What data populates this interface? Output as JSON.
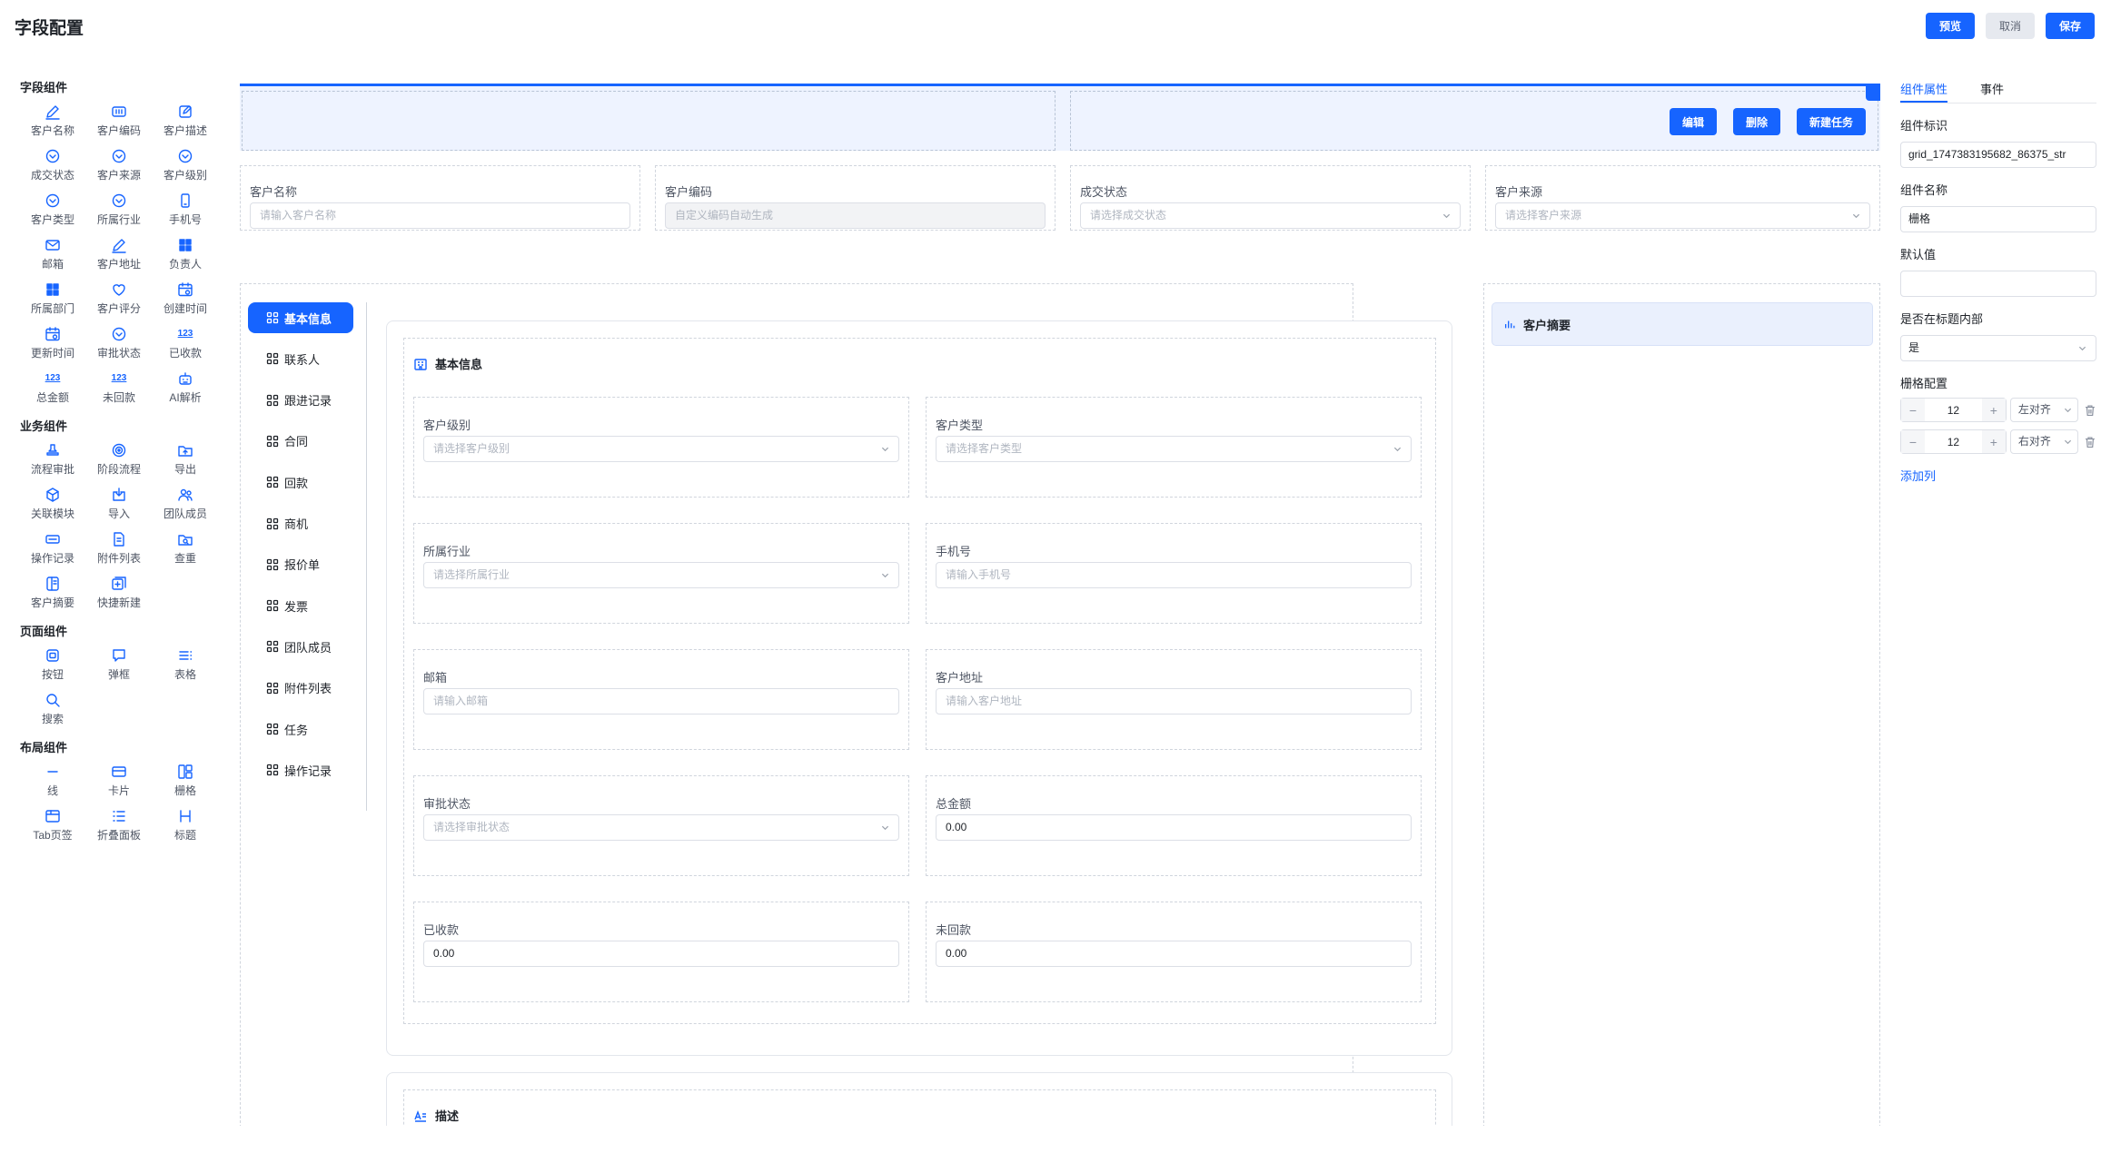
{
  "header": {
    "title": "字段配置",
    "actions": {
      "preview": "预览",
      "cancel": "取消",
      "save": "保存"
    }
  },
  "colors": {
    "primary": "#1664ff",
    "summary_bg": "#eaf0fd",
    "selected_bg": "#eef3ff"
  },
  "palette": {
    "sections": [
      {
        "title": "字段组件",
        "items": [
          {
            "label": "客户名称",
            "icon": "pen-icon"
          },
          {
            "label": "客户编码",
            "icon": "barcode-icon"
          },
          {
            "label": "客户描述",
            "icon": "edit-icon"
          },
          {
            "label": "成交状态",
            "icon": "chevron-circle-icon"
          },
          {
            "label": "客户来源",
            "icon": "chevron-circle-icon"
          },
          {
            "label": "客户级别",
            "icon": "chevron-circle-icon"
          },
          {
            "label": "客户类型",
            "icon": "chevron-circle-icon"
          },
          {
            "label": "所属行业",
            "icon": "chevron-circle-icon"
          },
          {
            "label": "手机号",
            "icon": "phone-icon"
          },
          {
            "label": "邮箱",
            "icon": "mail-icon"
          },
          {
            "label": "客户地址",
            "icon": "pen-icon"
          },
          {
            "label": "负责人",
            "icon": "grid-icon"
          },
          {
            "label": "所属部门",
            "icon": "grid-icon"
          },
          {
            "label": "客户评分",
            "icon": "heart-icon"
          },
          {
            "label": "创建时间",
            "icon": "calendar-icon"
          },
          {
            "label": "更新时间",
            "icon": "calendar-icon"
          },
          {
            "label": "审批状态",
            "icon": "chevron-circle-icon"
          },
          {
            "label": "已收款",
            "icon": "number-icon"
          },
          {
            "label": "总金额",
            "icon": "number-icon"
          },
          {
            "label": "未回款",
            "icon": "number-icon"
          },
          {
            "label": "AI解析",
            "icon": "robot-icon"
          }
        ]
      },
      {
        "title": "业务组件",
        "items": [
          {
            "label": "流程审批",
            "icon": "stamp-icon"
          },
          {
            "label": "阶段流程",
            "icon": "target-icon"
          },
          {
            "label": "导出",
            "icon": "export-icon"
          },
          {
            "label": "关联模块",
            "icon": "cube-icon"
          },
          {
            "label": "导入",
            "icon": "import-icon"
          },
          {
            "label": "团队成员",
            "icon": "team-icon"
          },
          {
            "label": "操作记录",
            "icon": "record-icon"
          },
          {
            "label": "附件列表",
            "icon": "file-icon"
          },
          {
            "label": "查重",
            "icon": "search-folder-icon"
          },
          {
            "label": "客户摘要",
            "icon": "summary-icon"
          },
          {
            "label": "快捷新建",
            "icon": "quick-add-icon"
          }
        ]
      },
      {
        "title": "页面组件",
        "items": [
          {
            "label": "按钮",
            "icon": "button-icon"
          },
          {
            "label": "弹框",
            "icon": "dialog-icon"
          },
          {
            "label": "表格",
            "icon": "table-icon"
          },
          {
            "label": "搜索",
            "icon": "search-icon"
          }
        ]
      },
      {
        "title": "布局组件",
        "items": [
          {
            "label": "线",
            "icon": "line-icon"
          },
          {
            "label": "卡片",
            "icon": "card-icon"
          },
          {
            "label": "栅格",
            "icon": "layout-icon"
          },
          {
            "label": "Tab页签",
            "icon": "tab-icon"
          },
          {
            "label": "折叠面板",
            "icon": "collapse-icon"
          },
          {
            "label": "标题",
            "icon": "heading-icon"
          }
        ]
      }
    ]
  },
  "canvas": {
    "grid_actions": {
      "edit": "编辑",
      "delete": "删除",
      "new_task": "新建任务"
    },
    "top_fields": [
      {
        "label": "客户名称",
        "placeholder": "请输入客户名称",
        "type": "input"
      },
      {
        "label": "客户编码",
        "placeholder": "自定义编码自动生成",
        "type": "disabled"
      },
      {
        "label": "成交状态",
        "placeholder": "请选择成交状态",
        "type": "select"
      },
      {
        "label": "客户来源",
        "placeholder": "请选择客户来源",
        "type": "select"
      }
    ],
    "nav": [
      "基本信息",
      "联系人",
      "跟进记录",
      "合同",
      "回款",
      "商机",
      "报价单",
      "发票",
      "团队成员",
      "附件列表",
      "任务",
      "操作记录"
    ],
    "basic_section": {
      "title": "基本信息",
      "fields": [
        {
          "label": "客户级别",
          "placeholder": "请选择客户级别",
          "type": "select"
        },
        {
          "label": "客户类型",
          "placeholder": "请选择客户类型",
          "type": "select"
        },
        {
          "label": "所属行业",
          "placeholder": "请选择所属行业",
          "type": "select"
        },
        {
          "label": "手机号",
          "placeholder": "请输入手机号",
          "type": "input"
        },
        {
          "label": "邮箱",
          "placeholder": "请输入邮箱",
          "type": "input"
        },
        {
          "label": "客户地址",
          "placeholder": "请输入客户地址",
          "type": "input"
        },
        {
          "label": "审批状态",
          "placeholder": "请选择审批状态",
          "type": "select"
        },
        {
          "label": "总金额",
          "value": "0.00",
          "type": "value"
        },
        {
          "label": "已收款",
          "value": "0.00",
          "type": "value"
        },
        {
          "label": "未回款",
          "value": "0.00",
          "type": "value"
        }
      ]
    },
    "desc_section": {
      "title": "描述"
    },
    "summary": {
      "title": "客户摘要"
    }
  },
  "props": {
    "tabs": [
      "组件属性",
      "事件"
    ],
    "id_label": "组件标识",
    "id_value": "grid_1747383195682_86375_str",
    "name_label": "组件名称",
    "name_value": "栅格",
    "default_label": "默认值",
    "default_value": "",
    "in_title_label": "是否在标题内部",
    "in_title_value": "是",
    "grid_label": "栅格配置",
    "grid_rows": [
      {
        "span": "12",
        "align": "左对齐"
      },
      {
        "span": "12",
        "align": "右对齐"
      }
    ],
    "add_column": "添加列"
  }
}
